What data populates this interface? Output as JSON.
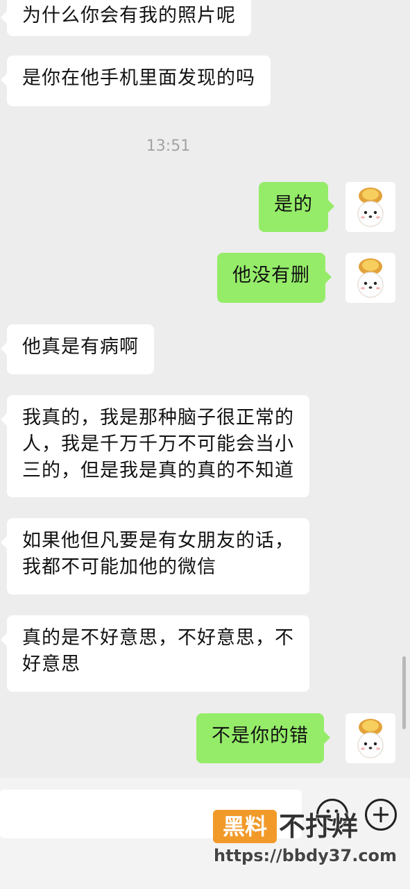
{
  "messages": {
    "m1": "为什么你会有我的照片呢",
    "m2": "是你在他手机里面发现的吗",
    "timestamp": "13:51",
    "m3": "是的",
    "m4": "他没有删",
    "m5": "他真是有病啊",
    "m6": "我真的，我是那种脑子很正常的\n人，我是千万千万不可能会当小\n三的，但是我是真的真的不知道",
    "m7": "如果他但凡要是有女朋友的话，\n我都不可能加他的微信",
    "m8": "真的是不好意思，不好意思，不\n好意思",
    "m9": "不是你的错"
  },
  "input_bar": {
    "emoji_icon": "smiley-face-icon",
    "add_icon": "plus-circle-icon"
  },
  "watermark": {
    "badge": "黑料",
    "text": "不打烊",
    "url": "https://bbdy37.com"
  }
}
